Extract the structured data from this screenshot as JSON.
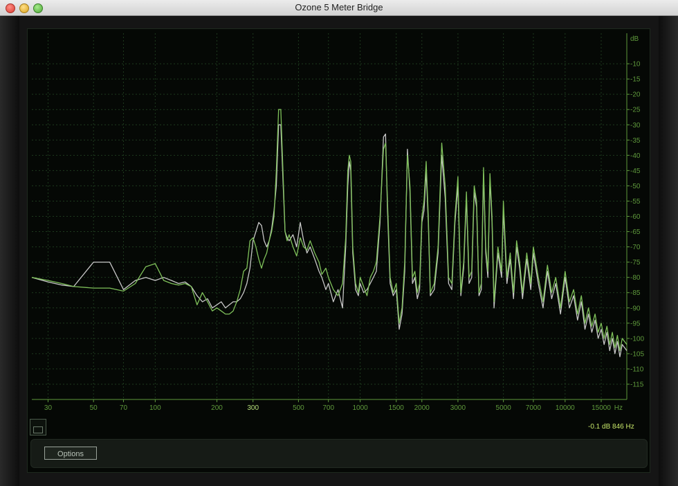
{
  "window": {
    "title": "Ozone 5 Meter Bridge"
  },
  "readout": {
    "text": "-0.1 dB 846 Hz"
  },
  "options": {
    "label": "Options"
  },
  "colors": {
    "green_trace": "#7fc15a",
    "white_trace": "#c8c8c8",
    "axis": "#5f9a3c",
    "grid": "#1e3a1e",
    "background": "#050805"
  },
  "chart_data": {
    "type": "line",
    "title": "",
    "xlabel": "Hz",
    "ylabel": "dB",
    "x_scale": "log",
    "xlim": [
      25,
      20000
    ],
    "ylim": [
      -120,
      0
    ],
    "x_ticks": [
      30,
      50,
      70,
      100,
      200,
      300,
      500,
      700,
      1000,
      1500,
      2000,
      3000,
      5000,
      7000,
      10000,
      15000
    ],
    "x_tick_labels": [
      "30",
      "50",
      "70",
      "100",
      "200",
      "300",
      "500",
      "700",
      "1000",
      "1500",
      "2000",
      "3000",
      "5000",
      "7000",
      "10000",
      "15000"
    ],
    "y_ticks": [
      -10,
      -15,
      -20,
      -25,
      -30,
      -35,
      -40,
      -45,
      -50,
      -55,
      -60,
      -65,
      -70,
      -75,
      -80,
      -85,
      -90,
      -95,
      -100,
      -105,
      -110,
      -115
    ],
    "y_tick_labels": [
      "-10",
      "-15",
      "-20",
      "-25",
      "-30",
      "-35",
      "-40",
      "-45",
      "-50",
      "-55",
      "-60",
      "-65",
      "-70",
      "-75",
      "-80",
      "-85",
      "-90",
      "-95",
      "-100",
      "-105",
      "-110",
      "-115"
    ],
    "grid": true,
    "series": [
      {
        "color": "#7fc15a",
        "points": [
          [
            25,
            -80
          ],
          [
            30,
            -81
          ],
          [
            35,
            -82
          ],
          [
            40,
            -83
          ],
          [
            50,
            -83.5
          ],
          [
            60,
            -83.5
          ],
          [
            70,
            -84.5
          ],
          [
            80,
            -82
          ],
          [
            90,
            -76.5
          ],
          [
            100,
            -75.5
          ],
          [
            110,
            -81
          ],
          [
            120,
            -82
          ],
          [
            130,
            -82.5
          ],
          [
            140,
            -82
          ],
          [
            150,
            -83
          ],
          [
            160,
            -89
          ],
          [
            170,
            -85
          ],
          [
            180,
            -88
          ],
          [
            190,
            -91
          ],
          [
            200,
            -90
          ],
          [
            210,
            -91
          ],
          [
            220,
            -92
          ],
          [
            230,
            -92
          ],
          [
            240,
            -91
          ],
          [
            250,
            -88
          ],
          [
            260,
            -84
          ],
          [
            270,
            -78
          ],
          [
            280,
            -77
          ],
          [
            290,
            -68
          ],
          [
            300,
            -67
          ],
          [
            310,
            -70
          ],
          [
            320,
            -74
          ],
          [
            330,
            -77
          ],
          [
            340,
            -74
          ],
          [
            350,
            -72
          ],
          [
            360,
            -68
          ],
          [
            370,
            -65
          ],
          [
            380,
            -60
          ],
          [
            390,
            -45
          ],
          [
            400,
            -25
          ],
          [
            410,
            -25
          ],
          [
            420,
            -45
          ],
          [
            430,
            -65
          ],
          [
            440,
            -68
          ],
          [
            450,
            -66
          ],
          [
            470,
            -70
          ],
          [
            490,
            -73
          ],
          [
            510,
            -67
          ],
          [
            530,
            -70
          ],
          [
            550,
            -71
          ],
          [
            570,
            -68
          ],
          [
            600,
            -72
          ],
          [
            630,
            -75
          ],
          [
            650,
            -79
          ],
          [
            680,
            -77
          ],
          [
            700,
            -80
          ],
          [
            740,
            -84
          ],
          [
            780,
            -86
          ],
          [
            820,
            -82
          ],
          [
            850,
            -67
          ],
          [
            870,
            -45
          ],
          [
            885,
            -40
          ],
          [
            900,
            -42
          ],
          [
            920,
            -70
          ],
          [
            950,
            -82
          ],
          [
            980,
            -85
          ],
          [
            1000,
            -80
          ],
          [
            1040,
            -83
          ],
          [
            1080,
            -86
          ],
          [
            1120,
            -80
          ],
          [
            1160,
            -78
          ],
          [
            1200,
            -75
          ],
          [
            1250,
            -60
          ],
          [
            1300,
            -38
          ],
          [
            1330,
            -36
          ],
          [
            1360,
            -55
          ],
          [
            1400,
            -80
          ],
          [
            1450,
            -85
          ],
          [
            1500,
            -82
          ],
          [
            1550,
            -95
          ],
          [
            1600,
            -90
          ],
          [
            1650,
            -75
          ],
          [
            1700,
            -40
          ],
          [
            1750,
            -50
          ],
          [
            1800,
            -80
          ],
          [
            1850,
            -78
          ],
          [
            1900,
            -85
          ],
          [
            1950,
            -82
          ],
          [
            2000,
            -60
          ],
          [
            2050,
            -55
          ],
          [
            2100,
            -42
          ],
          [
            2150,
            -60
          ],
          [
            2200,
            -85
          ],
          [
            2300,
            -82
          ],
          [
            2400,
            -70
          ],
          [
            2500,
            -36
          ],
          [
            2600,
            -50
          ],
          [
            2700,
            -80
          ],
          [
            2800,
            -82
          ],
          [
            2900,
            -60
          ],
          [
            3000,
            -47
          ],
          [
            3100,
            -85
          ],
          [
            3200,
            -75
          ],
          [
            3300,
            -52
          ],
          [
            3400,
            -80
          ],
          [
            3500,
            -78
          ],
          [
            3600,
            -50
          ],
          [
            3700,
            -55
          ],
          [
            3800,
            -85
          ],
          [
            3900,
            -82
          ],
          [
            4000,
            -44
          ],
          [
            4100,
            -70
          ],
          [
            4200,
            -78
          ],
          [
            4300,
            -46
          ],
          [
            4400,
            -60
          ],
          [
            4500,
            -88
          ],
          [
            4700,
            -70
          ],
          [
            4900,
            -78
          ],
          [
            5000,
            -55
          ],
          [
            5200,
            -80
          ],
          [
            5400,
            -72
          ],
          [
            5600,
            -85
          ],
          [
            5800,
            -68
          ],
          [
            6000,
            -75
          ],
          [
            6200,
            -85
          ],
          [
            6500,
            -72
          ],
          [
            6800,
            -82
          ],
          [
            7000,
            -70
          ],
          [
            7400,
            -80
          ],
          [
            7800,
            -88
          ],
          [
            8200,
            -76
          ],
          [
            8600,
            -85
          ],
          [
            9000,
            -80
          ],
          [
            9500,
            -90
          ],
          [
            10000,
            -78
          ],
          [
            10500,
            -88
          ],
          [
            11000,
            -84
          ],
          [
            11500,
            -92
          ],
          [
            12000,
            -86
          ],
          [
            12500,
            -95
          ],
          [
            13000,
            -90
          ],
          [
            13500,
            -96
          ],
          [
            14000,
            -92
          ],
          [
            14500,
            -98
          ],
          [
            15000,
            -95
          ],
          [
            15500,
            -100
          ],
          [
            16000,
            -96
          ],
          [
            16500,
            -102
          ],
          [
            17000,
            -98
          ],
          [
            17500,
            -103
          ],
          [
            18000,
            -99
          ],
          [
            18500,
            -104
          ],
          [
            19000,
            -100
          ],
          [
            20000,
            -102
          ]
        ]
      },
      {
        "color": "#c8c8c8",
        "points": [
          [
            25,
            -80
          ],
          [
            30,
            -81.5
          ],
          [
            35,
            -82.5
          ],
          [
            40,
            -83
          ],
          [
            50,
            -75
          ],
          [
            60,
            -75
          ],
          [
            70,
            -84
          ],
          [
            80,
            -81
          ],
          [
            90,
            -80
          ],
          [
            100,
            -81
          ],
          [
            110,
            -80
          ],
          [
            120,
            -81
          ],
          [
            130,
            -82
          ],
          [
            140,
            -81.5
          ],
          [
            150,
            -83
          ],
          [
            160,
            -86
          ],
          [
            170,
            -88
          ],
          [
            180,
            -87
          ],
          [
            190,
            -90
          ],
          [
            200,
            -89
          ],
          [
            210,
            -88
          ],
          [
            220,
            -90
          ],
          [
            230,
            -89
          ],
          [
            240,
            -88
          ],
          [
            250,
            -88
          ],
          [
            260,
            -87
          ],
          [
            270,
            -85
          ],
          [
            280,
            -82
          ],
          [
            290,
            -77
          ],
          [
            300,
            -68
          ],
          [
            310,
            -65
          ],
          [
            320,
            -62
          ],
          [
            330,
            -63
          ],
          [
            340,
            -68
          ],
          [
            350,
            -70
          ],
          [
            360,
            -68
          ],
          [
            370,
            -64
          ],
          [
            380,
            -58
          ],
          [
            390,
            -50
          ],
          [
            400,
            -30
          ],
          [
            410,
            -30
          ],
          [
            420,
            -48
          ],
          [
            430,
            -65
          ],
          [
            440,
            -67
          ],
          [
            450,
            -68
          ],
          [
            470,
            -66
          ],
          [
            490,
            -70
          ],
          [
            510,
            -62
          ],
          [
            530,
            -68
          ],
          [
            550,
            -72
          ],
          [
            570,
            -70
          ],
          [
            600,
            -74
          ],
          [
            630,
            -78
          ],
          [
            650,
            -80
          ],
          [
            680,
            -84
          ],
          [
            700,
            -82
          ],
          [
            740,
            -88
          ],
          [
            780,
            -84
          ],
          [
            820,
            -90
          ],
          [
            850,
            -70
          ],
          [
            870,
            -50
          ],
          [
            885,
            -42
          ],
          [
            900,
            -45
          ],
          [
            920,
            -72
          ],
          [
            950,
            -84
          ],
          [
            980,
            -86
          ],
          [
            1000,
            -82
          ],
          [
            1040,
            -85
          ],
          [
            1080,
            -84
          ],
          [
            1120,
            -82
          ],
          [
            1160,
            -80
          ],
          [
            1200,
            -78
          ],
          [
            1250,
            -62
          ],
          [
            1300,
            -34
          ],
          [
            1330,
            -33
          ],
          [
            1360,
            -58
          ],
          [
            1400,
            -82
          ],
          [
            1450,
            -86
          ],
          [
            1500,
            -84
          ],
          [
            1550,
            -97
          ],
          [
            1600,
            -92
          ],
          [
            1650,
            -78
          ],
          [
            1700,
            -38
          ],
          [
            1750,
            -52
          ],
          [
            1800,
            -82
          ],
          [
            1850,
            -80
          ],
          [
            1900,
            -87
          ],
          [
            1950,
            -84
          ],
          [
            2000,
            -62
          ],
          [
            2050,
            -58
          ],
          [
            2100,
            -45
          ],
          [
            2150,
            -62
          ],
          [
            2200,
            -86
          ],
          [
            2300,
            -84
          ],
          [
            2400,
            -72
          ],
          [
            2500,
            -40
          ],
          [
            2600,
            -54
          ],
          [
            2700,
            -82
          ],
          [
            2800,
            -84
          ],
          [
            2900,
            -62
          ],
          [
            3000,
            -50
          ],
          [
            3100,
            -86
          ],
          [
            3200,
            -77
          ],
          [
            3300,
            -54
          ],
          [
            3400,
            -82
          ],
          [
            3500,
            -80
          ],
          [
            3600,
            -52
          ],
          [
            3700,
            -57
          ],
          [
            3800,
            -86
          ],
          [
            3900,
            -84
          ],
          [
            4000,
            -46
          ],
          [
            4100,
            -72
          ],
          [
            4200,
            -80
          ],
          [
            4300,
            -48
          ],
          [
            4400,
            -62
          ],
          [
            4500,
            -90
          ],
          [
            4700,
            -72
          ],
          [
            4900,
            -80
          ],
          [
            5000,
            -58
          ],
          [
            5200,
            -82
          ],
          [
            5400,
            -74
          ],
          [
            5600,
            -87
          ],
          [
            5800,
            -70
          ],
          [
            6000,
            -77
          ],
          [
            6200,
            -87
          ],
          [
            6500,
            -74
          ],
          [
            6800,
            -84
          ],
          [
            7000,
            -72
          ],
          [
            7400,
            -82
          ],
          [
            7800,
            -90
          ],
          [
            8200,
            -78
          ],
          [
            8600,
            -87
          ],
          [
            9000,
            -82
          ],
          [
            9500,
            -92
          ],
          [
            10000,
            -80
          ],
          [
            10500,
            -90
          ],
          [
            11000,
            -86
          ],
          [
            11500,
            -94
          ],
          [
            12000,
            -88
          ],
          [
            12500,
            -97
          ],
          [
            13000,
            -92
          ],
          [
            13500,
            -98
          ],
          [
            14000,
            -94
          ],
          [
            14500,
            -100
          ],
          [
            15000,
            -97
          ],
          [
            15500,
            -102
          ],
          [
            16000,
            -98
          ],
          [
            16500,
            -104
          ],
          [
            17000,
            -100
          ],
          [
            17500,
            -105
          ],
          [
            18000,
            -101
          ],
          [
            18500,
            -106
          ],
          [
            19000,
            -102
          ],
          [
            20000,
            -104
          ]
        ]
      }
    ]
  }
}
